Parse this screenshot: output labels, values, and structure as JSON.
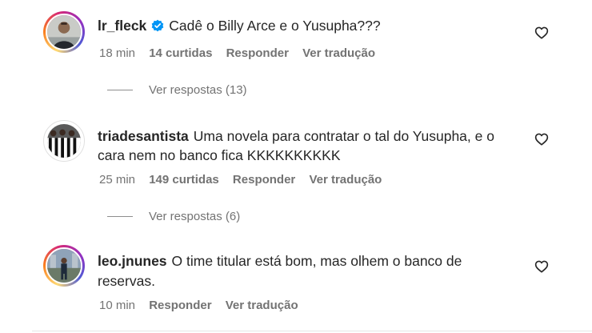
{
  "comments": [
    {
      "username": "lr_fleck",
      "verified": true,
      "text_lines": [
        "Cadê o Billy Arce e o Yusupha???"
      ],
      "time": "18 min",
      "likes": "14 curtidas",
      "reply": "Responder",
      "translate": "Ver tradução",
      "view_replies": "Ver respostas (13)"
    },
    {
      "username": "triadesantista",
      "verified": false,
      "text_lines": [
        "Uma novela para contratar o tal do Yusupha, e o",
        "cara nem no banco fica KKKKKKKKKK"
      ],
      "time": "25 min",
      "likes": "149 curtidas",
      "reply": "Responder",
      "translate": "Ver tradução",
      "view_replies": "Ver respostas (6)"
    },
    {
      "username": "leo.jnunes",
      "verified": false,
      "text_lines": [
        "O time titular está bom, mas olhem o banco de",
        "reservas."
      ],
      "time": "10 min",
      "reply": "Responder",
      "translate": "Ver tradução"
    }
  ],
  "icons": {
    "like": "heart-outline-icon",
    "verified": "verified-badge-icon"
  },
  "colors": {
    "text": "#262626",
    "secondary": "#737373",
    "verified_blue": "#0095f6"
  }
}
